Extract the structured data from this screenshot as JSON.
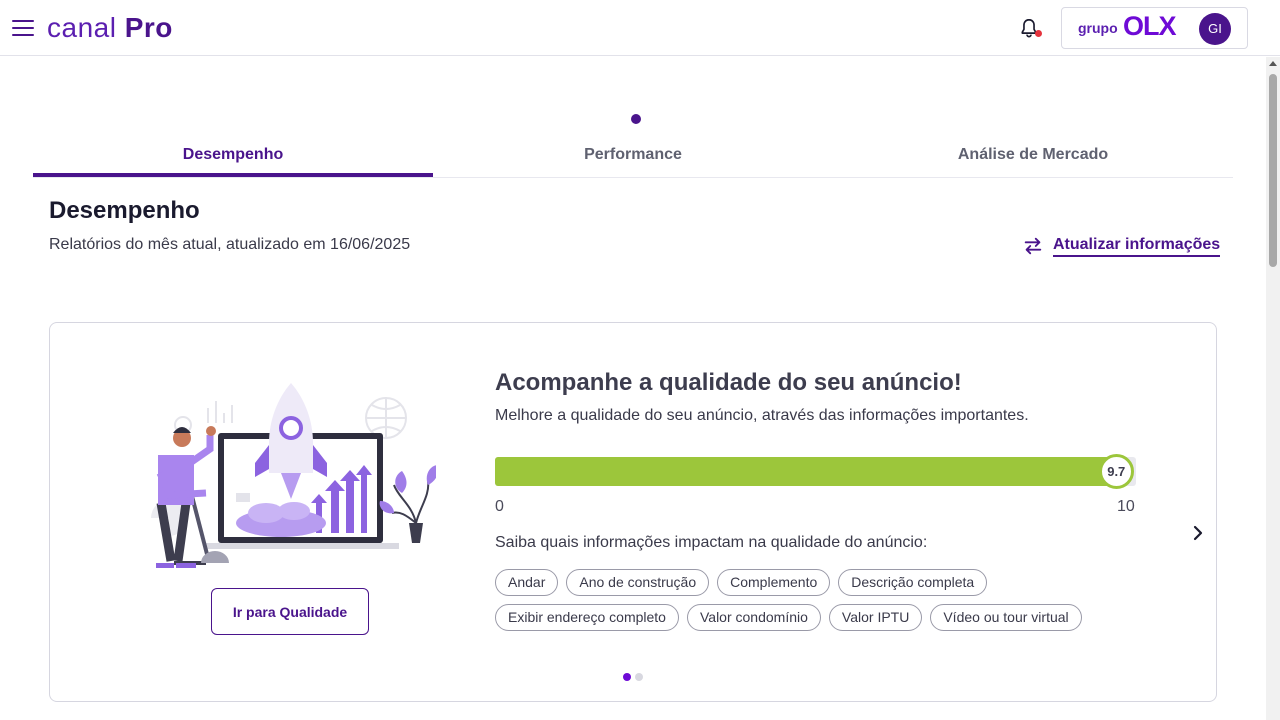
{
  "header": {
    "brand_light": "canal",
    "brand_bold": "Pro",
    "partner_prefix": "grupo",
    "partner_logo": "OLX",
    "avatar_initials": "GI",
    "icons": [
      "menu-icon",
      "bell-icon"
    ],
    "notification_dot_color": "#e5333d"
  },
  "tabs": [
    {
      "label": "Desempenho",
      "active": true
    },
    {
      "label": "Performance",
      "active": false
    },
    {
      "label": "Análise de Mercado",
      "active": false
    }
  ],
  "section": {
    "title": "Desempenho",
    "subtitle": "Relatórios do mês atual, atualizado em 16/06/2025",
    "refresh_label": "Atualizar informações",
    "refresh_icon": "swap-arrows-icon"
  },
  "card": {
    "title": "Acompanhe a qualidade do seu anúncio!",
    "subtitle": "Melhore a qualidade do seu anúncio, através das informações importantes.",
    "cta_label": "Ir para Qualidade",
    "score": {
      "value": 9.7,
      "label": "9.7",
      "min_label": "0",
      "max_label": "10",
      "max": 10
    },
    "chips_label": "Saiba quais informações impactam na qualidade do anúncio:",
    "chips": [
      "Andar",
      "Ano de construção",
      "Complemento",
      "Descrição completa",
      "Exibir endereço completo",
      "Valor condomínio",
      "Valor IPTU",
      "Vídeo ou tour virtual"
    ],
    "pager": {
      "pages": 2,
      "current": 1
    }
  },
  "colors": {
    "brand": "#4a148c",
    "olx_purple": "#6e0ad6",
    "score_green": "#9cc63b"
  }
}
